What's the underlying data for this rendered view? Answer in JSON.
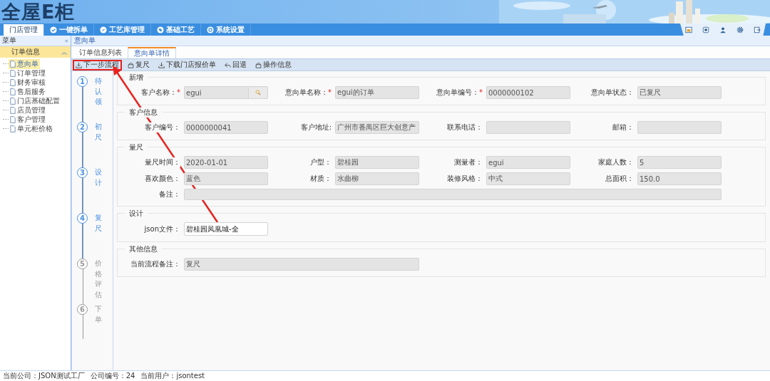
{
  "header": {
    "logo": "全屋E柜"
  },
  "nav": {
    "tabs": [
      {
        "label": "门店管理",
        "selected": true
      },
      {
        "label": "一键拆单",
        "selected": false
      },
      {
        "label": "工艺库管理",
        "selected": false
      },
      {
        "label": "基础工艺",
        "selected": false
      },
      {
        "label": "系统设置",
        "selected": false
      }
    ]
  },
  "sidebar": {
    "title": "菜单",
    "collapse": "«",
    "group": {
      "label": "订单信息",
      "toggle": "︽",
      "items": [
        {
          "label": "意向单",
          "selected": true
        },
        {
          "label": "订单管理",
          "selected": false
        },
        {
          "label": "财务审核",
          "selected": false
        },
        {
          "label": "售后服务",
          "selected": false
        },
        {
          "label": "门店基础配置",
          "selected": false
        },
        {
          "label": "店员管理",
          "selected": false
        },
        {
          "label": "客户管理",
          "selected": false
        },
        {
          "label": "单元柜价格",
          "selected": false
        }
      ]
    }
  },
  "breadcrumb": "意向单",
  "tabs": [
    {
      "label": "订单信息列表",
      "selected": false
    },
    {
      "label": "意向单详情",
      "selected": true
    }
  ],
  "toolbar": [
    {
      "label": "下一步流程",
      "highlighted": true
    },
    {
      "label": "复尺",
      "highlighted": false
    },
    {
      "label": "下载门店报价单",
      "highlighted": false
    },
    {
      "label": "回退",
      "highlighted": false
    },
    {
      "label": "操作信息",
      "highlighted": false
    }
  ],
  "steps": [
    {
      "number": "1",
      "label": "待认领",
      "done": true
    },
    {
      "number": "2",
      "label": "初尺",
      "done": true
    },
    {
      "number": "3",
      "label": "设计",
      "done": true
    },
    {
      "number": "4",
      "label": "复尺",
      "done": true
    },
    {
      "number": "5",
      "label": "价格评估",
      "done": false
    },
    {
      "number": "6",
      "label": "下单",
      "done": false
    }
  ],
  "sections": [
    {
      "title": "新增",
      "fields": [
        {
          "label": "客户名称：",
          "mark": "*",
          "value": "egui",
          "kind": "search"
        },
        {
          "label": "意向单名称：",
          "mark": "*",
          "value": "egui的订单",
          "kind": "text"
        },
        {
          "label": "意向单编号：",
          "mark": "*",
          "value": "0000000102",
          "kind": "text"
        },
        {
          "label": "意向单状态：",
          "value": "已复尺",
          "kind": "text"
        }
      ]
    },
    {
      "title": "客户信息",
      "fields": [
        {
          "label": "客户编号：",
          "value": "0000000041",
          "kind": "text"
        },
        {
          "label": "客户地址:",
          "value": "广州市番禺区巨大创意产",
          "kind": "text"
        },
        {
          "label": "联系电话：",
          "kind": "text"
        },
        {
          "label": "邮箱：",
          "kind": "text"
        }
      ]
    },
    {
      "title": "量尺",
      "fields": [
        {
          "label": "量尺时间：",
          "value": "2020-01-01",
          "kind": "text"
        },
        {
          "label": "户型：",
          "value": "碧桂园",
          "kind": "text"
        },
        {
          "label": "测量者：",
          "value": "egui",
          "kind": "text"
        },
        {
          "label": "家庭人数：",
          "value": "5",
          "kind": "text"
        },
        {
          "label": "喜欢颜色：",
          "value": "蓝色",
          "kind": "text"
        },
        {
          "label": "材质：",
          "value": "水曲柳",
          "kind": "text"
        },
        {
          "label": "装修风格：",
          "value": "中式",
          "kind": "text"
        },
        {
          "label": "总面积：",
          "value": "150.0",
          "kind": "text"
        },
        {
          "label": "备注：",
          "kind": "textarea"
        }
      ]
    },
    {
      "title": "设计",
      "fields": [
        {
          "label": "json文件：",
          "value": "碧桂园凤凰城-全",
          "kind": "editable"
        }
      ]
    },
    {
      "title": "其他信息",
      "fields": [
        {
          "label": "当前流程备注：",
          "value": "复尺",
          "kind": "wide"
        }
      ]
    }
  ],
  "status_bar": [
    "当前公司：JSON测试工厂",
    "公司编号：24",
    "当前用户：jsontest"
  ]
}
